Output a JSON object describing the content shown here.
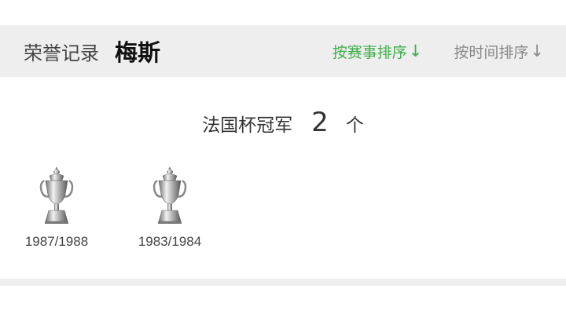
{
  "header": {
    "section_title": "荣誉记录",
    "team_name": "梅斯",
    "sort_by_competition": "按赛事排序",
    "sort_by_time": "按时间排序",
    "arrow": "↓",
    "active_color": "#3fae49",
    "inactive_color": "#888888"
  },
  "honor": {
    "competition": "法国杯冠军",
    "count": "2",
    "unit": "个",
    "trophies": [
      {
        "season": "1987/1988",
        "icon": "trophy-icon"
      },
      {
        "season": "1983/1984",
        "icon": "trophy-icon"
      }
    ]
  }
}
